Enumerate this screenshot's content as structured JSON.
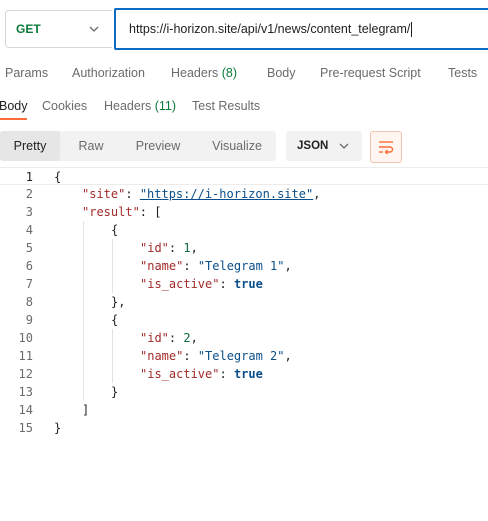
{
  "request": {
    "method": "GET",
    "url": "https://i-horizon.site/api/v1/news/content_telegram/"
  },
  "request_tabs": [
    {
      "label": "Params",
      "count": ""
    },
    {
      "label": "Authorization",
      "count": ""
    },
    {
      "label": "Headers",
      "count": "(8)"
    },
    {
      "label": "Body",
      "count": ""
    },
    {
      "label": "Pre-request Script",
      "count": ""
    },
    {
      "label": "Tests",
      "count": ""
    }
  ],
  "response_tabs": [
    {
      "label": "Body",
      "count": ""
    },
    {
      "label": "Cookies",
      "count": ""
    },
    {
      "label": "Headers",
      "count": "(11)"
    },
    {
      "label": "Test Results",
      "count": ""
    }
  ],
  "view_modes": [
    "Pretty",
    "Raw",
    "Preview",
    "Visualize"
  ],
  "format": "JSON",
  "colors": {
    "accent": "#ff6c37",
    "url_border": "#0b6bc7",
    "method_get": "#0a7a3a",
    "json_key": "#a22b2b",
    "json_string": "#0b4f8a",
    "json_number": "#0b6b3a"
  },
  "code_lines": [
    {
      "n": "1",
      "text": "{"
    },
    {
      "n": "2",
      "key": "\"site\"",
      "sep": ": ",
      "link": "\"https://i-horizon.site\"",
      "tail": ","
    },
    {
      "n": "3",
      "key": "\"result\"",
      "sep": ": [",
      "tail": ""
    },
    {
      "n": "4",
      "text": "{"
    },
    {
      "n": "5",
      "key": "\"id\"",
      "sep": ": ",
      "num": "1",
      "tail": ","
    },
    {
      "n": "6",
      "key": "\"name\"",
      "sep": ": ",
      "str": "\"Telegram 1\"",
      "tail": ","
    },
    {
      "n": "7",
      "key": "\"is_active\"",
      "sep": ": ",
      "bool": "true",
      "tail": ""
    },
    {
      "n": "8",
      "text": "},"
    },
    {
      "n": "9",
      "text": "{"
    },
    {
      "n": "10",
      "key": "\"id\"",
      "sep": ": ",
      "num": "2",
      "tail": ","
    },
    {
      "n": "11",
      "key": "\"name\"",
      "sep": ": ",
      "str": "\"Telegram 2\"",
      "tail": ","
    },
    {
      "n": "12",
      "key": "\"is_active\"",
      "sep": ": ",
      "bool": "true",
      "tail": ""
    },
    {
      "n": "13",
      "text": "}"
    },
    {
      "n": "14",
      "text": "]"
    },
    {
      "n": "15",
      "text": "}"
    }
  ]
}
